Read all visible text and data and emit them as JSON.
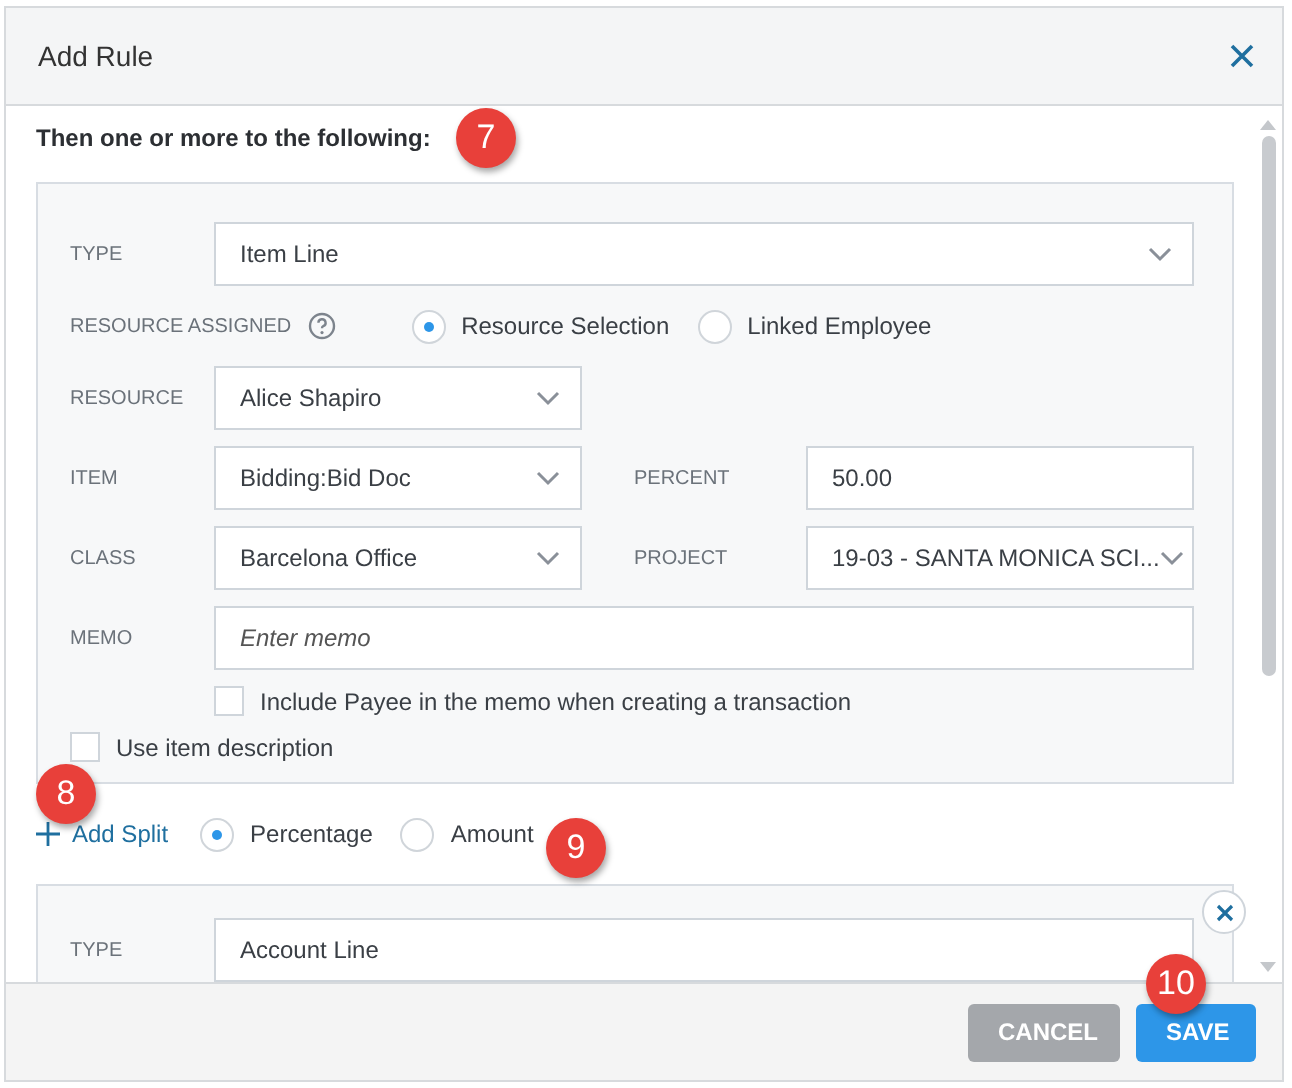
{
  "dialog": {
    "title": "Add Rule"
  },
  "section_heading": "Then one or more to the following:",
  "rule_panel": {
    "type": {
      "label": "TYPE",
      "value": "Item Line"
    },
    "resource_assigned": {
      "label": "RESOURCE ASSIGNED",
      "options": [
        {
          "label": "Resource Selection",
          "selected": true
        },
        {
          "label": "Linked Employee",
          "selected": false
        }
      ]
    },
    "resource": {
      "label": "RESOURCE",
      "value": "Alice Shapiro"
    },
    "item": {
      "label": "ITEM",
      "value": "Bidding:Bid Doc"
    },
    "percent": {
      "label": "PERCENT",
      "value": "50.00"
    },
    "class": {
      "label": "CLASS",
      "value": "Barcelona Office"
    },
    "project": {
      "label": "PROJECT",
      "value": "19-03 - SANTA MONICA SCI..."
    },
    "memo": {
      "label": "MEMO",
      "placeholder": "Enter memo"
    },
    "include_payee": {
      "label": "Include Payee in the memo when creating a transaction",
      "checked": false
    },
    "use_item_description": {
      "label": "Use item description",
      "checked": false
    }
  },
  "split": {
    "add_label": "Add Split",
    "options": [
      {
        "label": "Percentage",
        "selected": true
      },
      {
        "label": "Amount",
        "selected": false
      }
    ]
  },
  "second_panel": {
    "type": {
      "label": "TYPE",
      "value": "Account Line"
    }
  },
  "footer": {
    "buttons": [
      {
        "label": "CANCEL",
        "kind": "secondary"
      },
      {
        "label": "SAVE",
        "kind": "primary"
      }
    ]
  },
  "callouts": [
    "7",
    "8",
    "9",
    "10"
  ]
}
